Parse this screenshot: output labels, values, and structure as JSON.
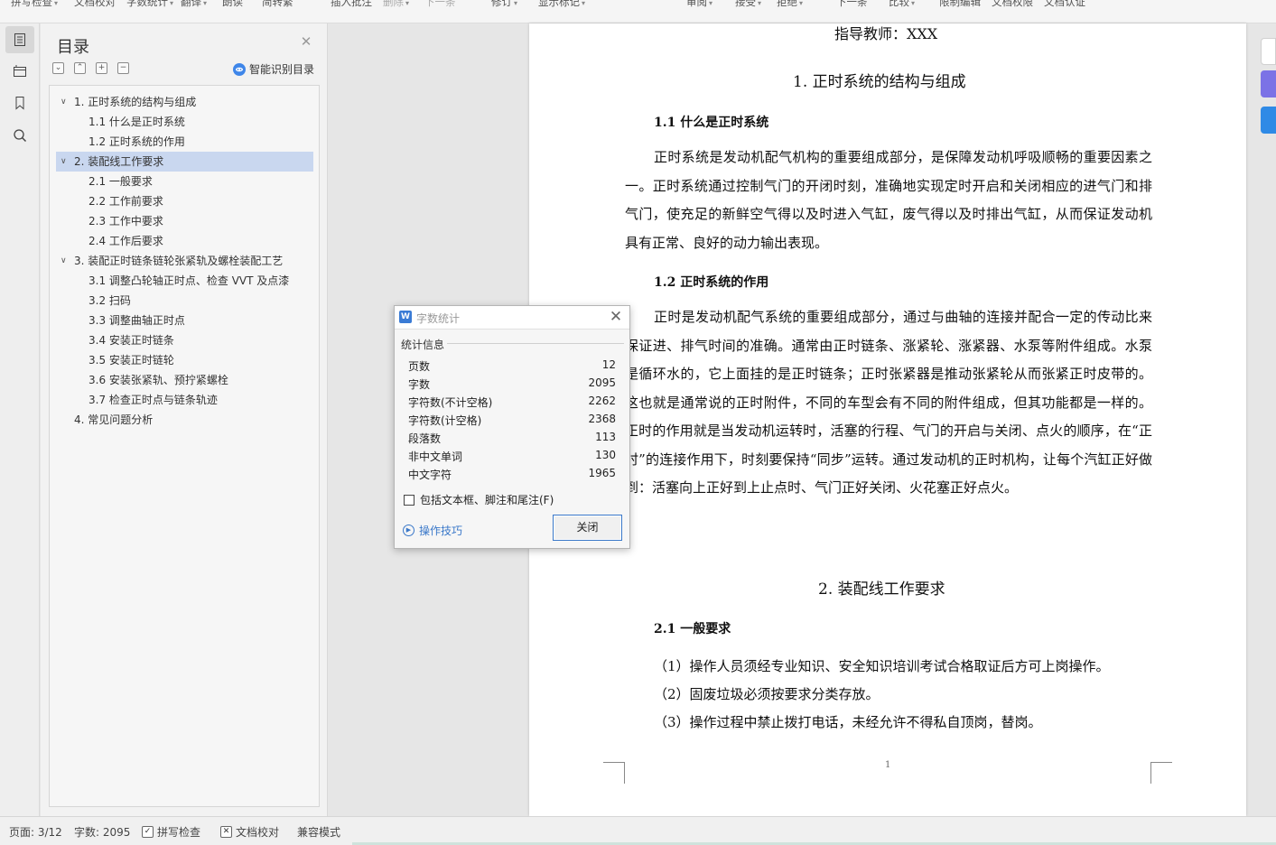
{
  "toolbar": {
    "items": [
      "拼写检查",
      "文档校对",
      "字数统计",
      "翻译",
      "朗读",
      "简转繁",
      "插入批注",
      "删除",
      "下一条",
      "修订",
      "显示标记",
      "审阅",
      "接受",
      "拒绝",
      "下一条",
      "比较",
      "限制编辑",
      "文档权限",
      "文档认证"
    ]
  },
  "toc": {
    "title": "目录",
    "smart_label": "智能识别目录",
    "items": [
      {
        "label": "1. 正时系统的结构与组成",
        "level": 1
      },
      {
        "label": "1.1  什么是正时系统",
        "level": 2
      },
      {
        "label": "1.2  正时系统的作用",
        "level": 2
      },
      {
        "label": "2. 装配线工作要求",
        "level": 1,
        "selected": true
      },
      {
        "label": "2.1  一般要求",
        "level": 2
      },
      {
        "label": "2.2  工作前要求",
        "level": 2
      },
      {
        "label": "2.3  工作中要求",
        "level": 2
      },
      {
        "label": "2.4  工作后要求",
        "level": 2
      },
      {
        "label": "3. 装配正时链条链轮张紧轨及螺栓装配工艺",
        "level": 1
      },
      {
        "label": "3.1  调整凸轮轴正时点、检查 VVT 及点漆",
        "level": 2
      },
      {
        "label": "3.2  扫码",
        "level": 2
      },
      {
        "label": "3.3  调整曲轴正时点",
        "level": 2
      },
      {
        "label": "3.4  安装正时链条",
        "level": 2
      },
      {
        "label": "3.5  安装正时链轮",
        "level": 2
      },
      {
        "label": "3.6  安装张紧轨、预拧紧螺栓",
        "level": 2
      },
      {
        "label": "3.7  检查正时点与链条轨迹",
        "level": 2
      },
      {
        "label": "4.  常见问题分析",
        "level": 1,
        "noarrow": true
      }
    ]
  },
  "document": {
    "advisor": "指导教师：XXX",
    "h1_1": "1.  正时系统的结构与组成",
    "h2_1": "1.1  什么是正时系统",
    "p1": "正时系统是发动机配气机构的重要组成部分，是保障发动机呼吸顺畅的重要因素之一。正时系统通过控制气门的开闭时刻，准确地实现定时开启和关闭相应的进气门和排气门，使充足的新鲜空气得以及时进入气缸，废气得以及时排出气缸，从而保证发动机具有正常、良好的动力输出表现。",
    "h2_2": "1.2  正时系统的作用",
    "p2": "正时是发动机配气系统的重要组成部分，通过与曲轴的连接并配合一定的传动比来保证进、排气时间的准确。通常由正时链条、涨紧轮、涨紧器、水泵等附件组成。水泵是循环水的，它上面挂的是正时链条；正时张紧器是推动张紧轮从而张紧正时皮带的。这也就是通常说的正时附件，不同的车型会有不同的附件组成，但其功能都是一样的。正时的作用就是当发动机运转时，活塞的行程、气门的开启与关闭、点火的顺序，在“正时”的连接作用下，时刻要保持“同步”运转。通过发动机的正时机构，让每个汽缸正好做到：活塞向上正好到上止点时、气门正好关闭、火花塞正好点火。",
    "h1_2": "2.  装配线工作要求",
    "h2_3": "2.1  一般要求",
    "li1": "（1）操作人员须经专业知识、安全知识培训考试合格取证后方可上岗操作。",
    "li2": "（2）固废垃圾必须按要求分类存放。",
    "li3": "（3）操作过程中禁止拨打电话，未经允许不得私自顶岗，替岗。",
    "page_number": "1"
  },
  "dialog": {
    "title": "字数统计",
    "group": "统计信息",
    "stats": [
      {
        "label": "页数",
        "value": "12"
      },
      {
        "label": "字数",
        "value": "2095"
      },
      {
        "label": "字符数(不计空格)",
        "value": "2262"
      },
      {
        "label": "字符数(计空格)",
        "value": "2368"
      },
      {
        "label": "段落数",
        "value": "113"
      },
      {
        "label": "非中文单词",
        "value": "130"
      },
      {
        "label": "中文字符",
        "value": "1965"
      }
    ],
    "checkbox_label": "包括文本框、脚注和尾注(F)",
    "tips_label": "操作技巧",
    "close_label": "关闭"
  },
  "status": {
    "page": "页面: 3/12",
    "words": "字数: 2095",
    "spell": "拼写检查",
    "proof": "文档校对",
    "compat": "兼容模式"
  },
  "colors": {
    "accent": "#3a78c9",
    "selected_row": "#c9d7ef"
  }
}
